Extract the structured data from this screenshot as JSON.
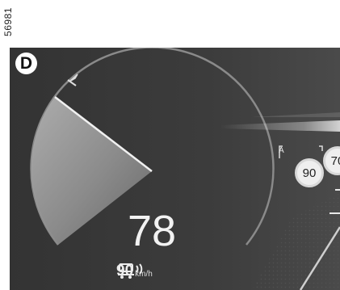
{
  "figure_ref": "56981",
  "cluster": {
    "gear": "D",
    "speed": "78",
    "cruise": {
      "icon": "cruise-control-icon",
      "set_speed": "90",
      "unit": "km/h"
    },
    "speed_sign": {
      "label": "A",
      "value": "90"
    },
    "speed_sign_next": {
      "value": "70"
    }
  },
  "colors": {
    "background": "#3a3a3a",
    "text": "#f2f2f2"
  }
}
